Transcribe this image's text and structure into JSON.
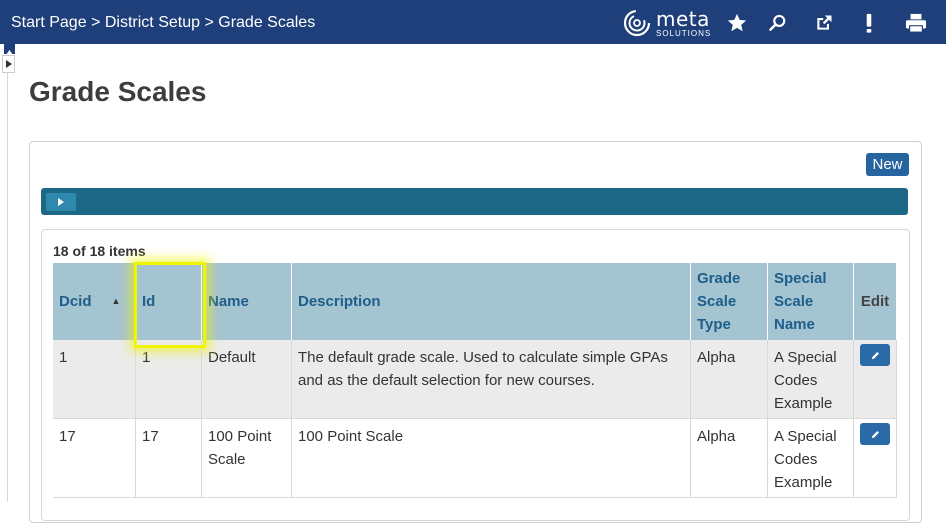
{
  "header": {
    "breadcrumb": [
      "Start Page",
      "District Setup",
      "Grade Scales"
    ],
    "separator": ">",
    "logo": {
      "name": "meta",
      "sub": "SOLUTIONS"
    },
    "icons": [
      "star-icon",
      "search-icon",
      "external-link-icon",
      "alert-icon",
      "print-icon"
    ]
  },
  "page": {
    "title": "Grade Scales"
  },
  "toolbar": {
    "new_label": "New"
  },
  "grid": {
    "count_label": "18 of 18 items",
    "columns": {
      "dcid": "Dcid",
      "id": "Id",
      "name": "Name",
      "description": "Description",
      "grade_scale_type": [
        "Grade",
        "Scale",
        "Type"
      ],
      "special_scale_name": [
        "Special",
        "Scale",
        "Name"
      ],
      "edit": "Edit"
    },
    "sort": {
      "column": "Dcid",
      "direction": "ascending"
    },
    "rows": [
      {
        "dcid": "1",
        "id": "1",
        "name": [
          "Default"
        ],
        "description": [
          "The default grade scale. Used to calculate simple GPAs",
          "and as the default selection for new courses."
        ],
        "type": "Alpha",
        "special": [
          "A Special",
          "Codes",
          "Example"
        ]
      },
      {
        "dcid": "17",
        "id": "17",
        "name": [
          "100 Point",
          "Scale"
        ],
        "description": [
          "100 Point Scale"
        ],
        "type": "Alpha",
        "special": [
          "A Special",
          "Codes",
          "Example"
        ]
      }
    ]
  },
  "colors": {
    "topbar": "#1f3f7a",
    "header_bg": "#a5c4d1",
    "header_text": "#1d5e8a",
    "filter_bar": "#1d6787",
    "button": "#26649f",
    "highlight": "#f0f500"
  }
}
